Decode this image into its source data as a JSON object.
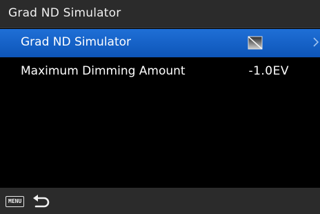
{
  "header": {
    "title": "Grad ND Simulator"
  },
  "menu": {
    "items": [
      {
        "label": "Grad ND Simulator",
        "value_icon": "grad-nd-off-icon",
        "selected": true
      },
      {
        "label": "Maximum Dimming Amount",
        "value": "-1.0EV",
        "selected": false
      }
    ]
  },
  "footer": {
    "menu_label": "MENU",
    "back_icon": "return-arrow-icon"
  },
  "colors": {
    "selection": "#1565c8",
    "header": "#2b2b2b",
    "background": "#000000"
  }
}
